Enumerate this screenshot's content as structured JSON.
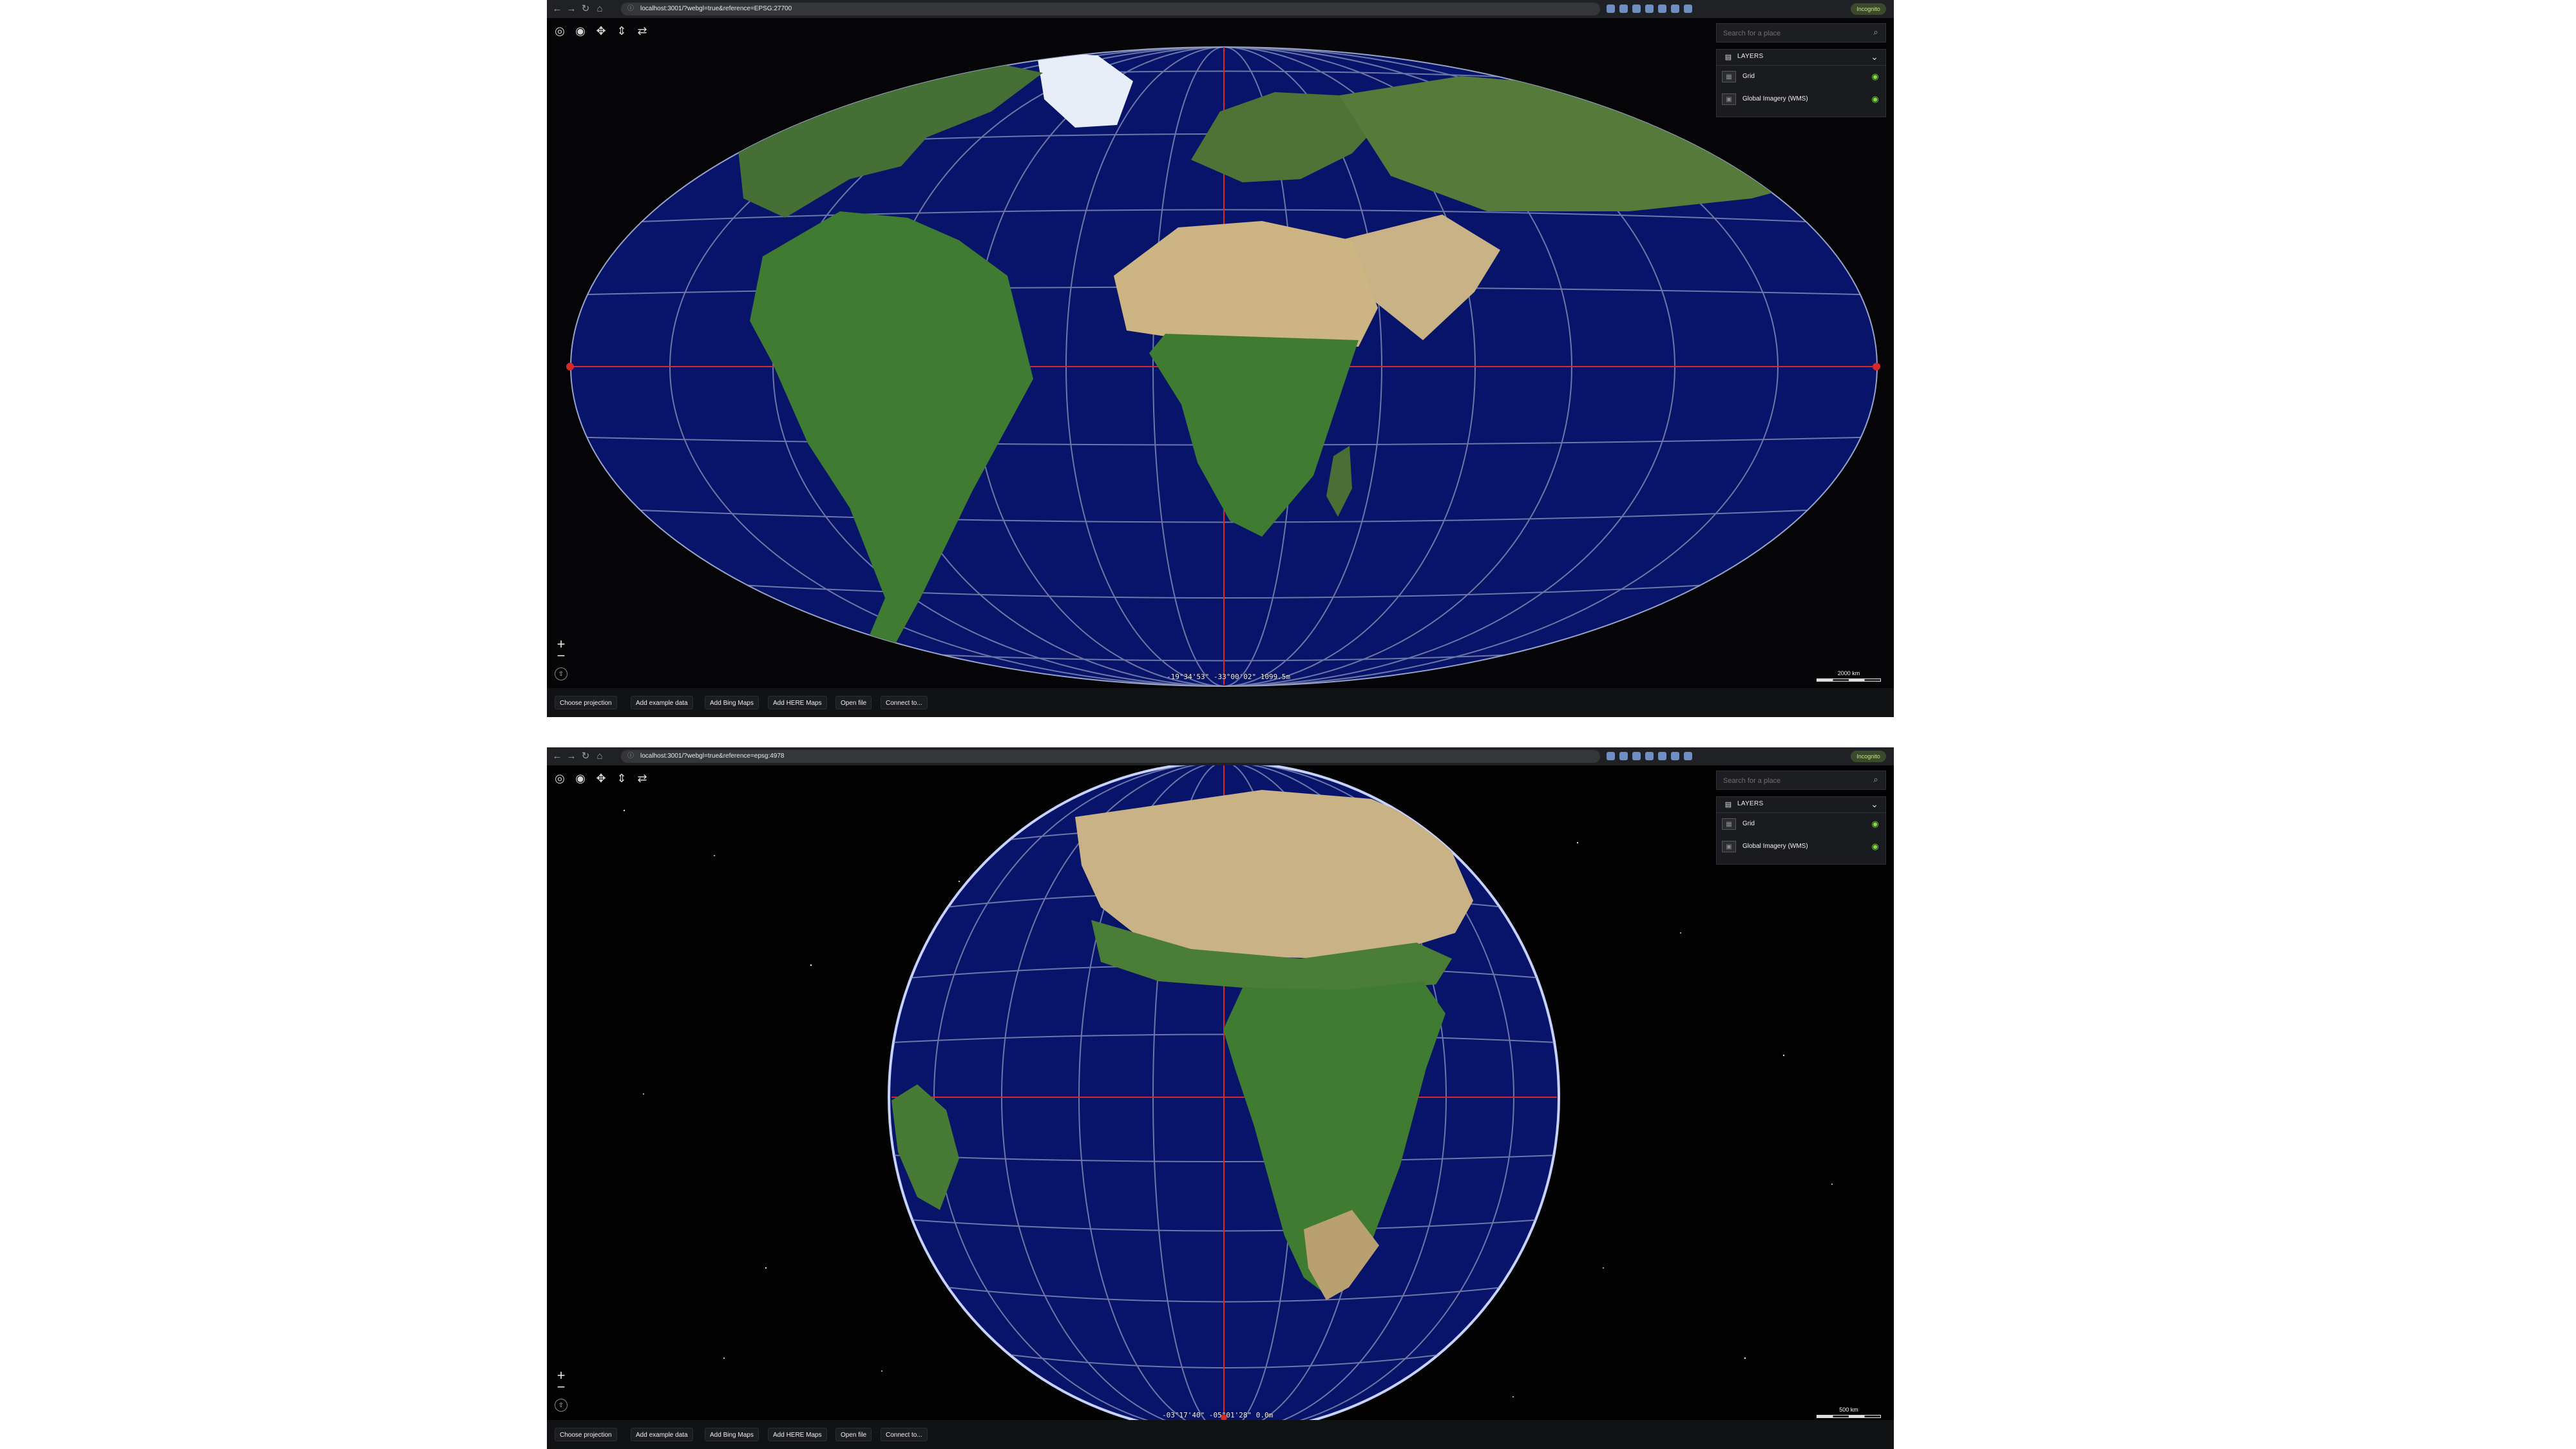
{
  "views": [
    {
      "url": "localhost:3001/?webgl=true&reference=EPSG:27700",
      "search": {
        "placeholder": "Search for a place"
      },
      "layers": {
        "title": "LAYERS",
        "items": [
          {
            "name": "Grid",
            "visible": true
          },
          {
            "name": "Global Imagery (WMS)",
            "visible": true
          }
        ]
      },
      "coordinates": "-19°34'53\" -33°00'02\" 1099.5m",
      "scale": "2000 km",
      "bottom_buttons": [
        "Choose projection",
        "Add example data",
        "Add Bing Maps",
        "Add HERE Maps",
        "Open file",
        "Connect to..."
      ]
    },
    {
      "url": "localhost:3001/?webgl=true&reference=epsg:4978",
      "search": {
        "placeholder": "Search for a place"
      },
      "layers": {
        "title": "LAYERS",
        "items": [
          {
            "name": "Grid",
            "visible": true
          },
          {
            "name": "Global Imagery (WMS)",
            "visible": true
          }
        ]
      },
      "coordinates": "-03°17'40\" -05°01'28\" 0.0m",
      "scale": "500 km",
      "bottom_buttons": [
        "Choose projection",
        "Add example data",
        "Add Bing Maps",
        "Add HERE Maps",
        "Open file",
        "Connect to..."
      ]
    }
  ],
  "chrome": {
    "nav_icons": [
      "back-icon",
      "forward-icon",
      "reload-icon",
      "home-icon"
    ],
    "profile_label": "Incognito"
  },
  "colors": {
    "ocean": "#07146a",
    "grid": "#9ca7c4",
    "axis": "#d52a2a",
    "land": "#3f7832",
    "desert": "#c8b286",
    "ice": "#e8eef7"
  }
}
